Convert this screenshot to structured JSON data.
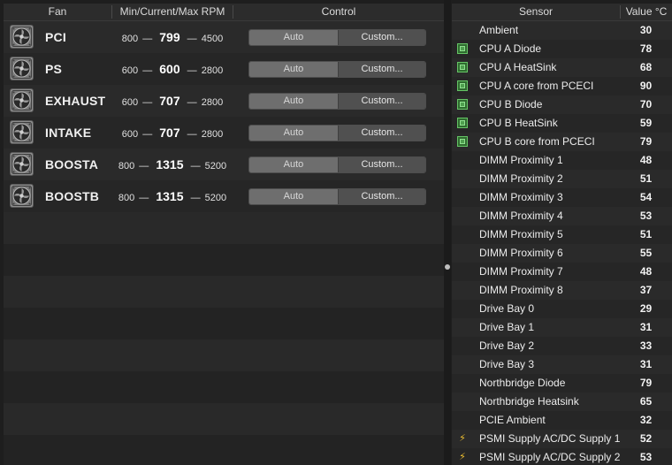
{
  "fan_table": {
    "columns": {
      "fan": "Fan",
      "rpm": "Min/Current/Max RPM",
      "control": "Control"
    },
    "control_labels": {
      "auto": "Auto",
      "custom": "Custom..."
    },
    "dash": "—",
    "rows": [
      {
        "name": "PCI",
        "min": "800",
        "current": "799",
        "max": "4500"
      },
      {
        "name": "PS",
        "min": "600",
        "current": "600",
        "max": "2800"
      },
      {
        "name": "EXHAUST",
        "min": "600",
        "current": "707",
        "max": "2800"
      },
      {
        "name": "INTAKE",
        "min": "600",
        "current": "707",
        "max": "2800"
      },
      {
        "name": "BOOSTA",
        "min": "800",
        "current": "1315",
        "max": "5200"
      },
      {
        "name": "BOOSTB",
        "min": "800",
        "current": "1315",
        "max": "5200"
      }
    ]
  },
  "sensor_table": {
    "columns": {
      "sensor": "Sensor",
      "value": "Value °C"
    },
    "rows": [
      {
        "name": "Ambient",
        "value": "30",
        "icon": "none"
      },
      {
        "name": "CPU A Diode",
        "value": "78",
        "icon": "chip"
      },
      {
        "name": "CPU A HeatSink",
        "value": "68",
        "icon": "chip"
      },
      {
        "name": "CPU A core from PCECI",
        "value": "90",
        "icon": "chip"
      },
      {
        "name": "CPU B Diode",
        "value": "70",
        "icon": "chip"
      },
      {
        "name": "CPU B HeatSink",
        "value": "59",
        "icon": "chip"
      },
      {
        "name": "CPU B core from PCECI",
        "value": "79",
        "icon": "chip"
      },
      {
        "name": "DIMM Proximity 1",
        "value": "48",
        "icon": "none"
      },
      {
        "name": "DIMM Proximity 2",
        "value": "51",
        "icon": "none"
      },
      {
        "name": "DIMM Proximity 3",
        "value": "54",
        "icon": "none"
      },
      {
        "name": "DIMM Proximity 4",
        "value": "53",
        "icon": "none"
      },
      {
        "name": "DIMM Proximity 5",
        "value": "51",
        "icon": "none"
      },
      {
        "name": "DIMM Proximity 6",
        "value": "55",
        "icon": "none"
      },
      {
        "name": "DIMM Proximity 7",
        "value": "48",
        "icon": "none"
      },
      {
        "name": "DIMM Proximity 8",
        "value": "37",
        "icon": "none"
      },
      {
        "name": "Drive Bay 0",
        "value": "29",
        "icon": "none"
      },
      {
        "name": "Drive Bay 1",
        "value": "31",
        "icon": "none"
      },
      {
        "name": "Drive Bay 2",
        "value": "33",
        "icon": "none"
      },
      {
        "name": "Drive Bay 3",
        "value": "31",
        "icon": "none"
      },
      {
        "name": "Northbridge Diode",
        "value": "79",
        "icon": "none"
      },
      {
        "name": "Northbridge Heatsink",
        "value": "65",
        "icon": "none"
      },
      {
        "name": "PCIE Ambient",
        "value": "32",
        "icon": "none"
      },
      {
        "name": "PSMI Supply AC/DC Supply 1",
        "value": "52",
        "icon": "bolt"
      },
      {
        "name": "PSMI Supply AC/DC Supply 2",
        "value": "53",
        "icon": "bolt"
      }
    ]
  }
}
